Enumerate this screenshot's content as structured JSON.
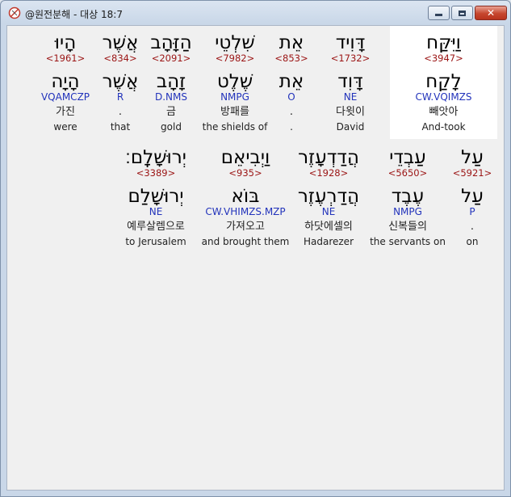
{
  "window": {
    "title": "@원전분해 - 대상 18:7",
    "app_icon": "app-logo-icon",
    "controls": {
      "minimize": "minimize-icon",
      "maximize": "maximize-icon",
      "close": "close-icon"
    }
  },
  "colors": {
    "hebrew": "#000000",
    "strong": "#9b1515",
    "morph": "#2233bb",
    "gloss": "#222222",
    "highlight": "#ffffff",
    "panel": "#f0f0f0"
  },
  "rows": [
    {
      "words": [
        {
          "heb_top": "וַיִּקַּח",
          "strong": "<3947>",
          "heb_bottom": "לָקַח",
          "morph": "CW.VQIMZS",
          "korean": "빼앗아",
          "english": "And-took",
          "highlighted": true
        },
        {
          "heb_top": "דָּוִיד",
          "strong": "<1732>",
          "heb_bottom": "דָּוִד",
          "morph": "NE",
          "korean": "다윗이",
          "english": "David"
        },
        {
          "heb_top": "אֵת",
          "strong": "<853>",
          "heb_bottom": "אֵת",
          "morph": "O",
          "korean": ".",
          "english": "."
        },
        {
          "heb_top": "שִׁלְטֵי",
          "strong": "<7982>",
          "heb_bottom": "שֶׁלֶט",
          "morph": "NMPG",
          "korean": "방패를",
          "english": "the shields of"
        },
        {
          "heb_top": "הַזָּהָב",
          "strong": "<2091>",
          "heb_bottom": "זָהָב",
          "morph": "D.NMS",
          "korean": "금",
          "english": "gold"
        },
        {
          "heb_top": "אֲשֶׁר",
          "strong": "<834>",
          "heb_bottom": "אֲשֶׁר",
          "morph": "R",
          "korean": ".",
          "english": "that"
        },
        {
          "heb_top": "הָיוּ",
          "strong": "<1961>",
          "heb_bottom": "הָיָה",
          "morph": "VQAMCZP",
          "korean": "가진",
          "english": "were"
        }
      ]
    },
    {
      "words": [
        {
          "heb_top": "עַל",
          "strong": "<5921>",
          "heb_bottom": "עַל",
          "morph": "P",
          "korean": ".",
          "english": "on"
        },
        {
          "heb_top": "עַבְדֵי",
          "strong": "<5650>",
          "heb_bottom": "עֶבֶד",
          "morph": "NMPG",
          "korean": "신복들의",
          "english": "the servants on"
        },
        {
          "heb_top": "הֲדַדְעָזֶר",
          "strong": "<1928>",
          "heb_bottom": "הֲדַרְעֶזֶר",
          "morph": "NE",
          "korean": "하닷에셀의",
          "english": "Hadarezer"
        },
        {
          "heb_top": "וַיְבִיאֵם",
          "strong": "<935>",
          "heb_bottom": "בּוֹא",
          "morph": "CW.VHIMZS.MZP",
          "korean": "가져오고",
          "english": "and brought them"
        },
        {
          "heb_top": "יְרוּשָׁלָֽם׃",
          "strong": "<3389>",
          "heb_bottom": "יְרוּשָׁלַ͏ִם",
          "morph": "NE",
          "korean": "예루살렘으로",
          "english": "to Jerusalem"
        }
      ]
    }
  ]
}
